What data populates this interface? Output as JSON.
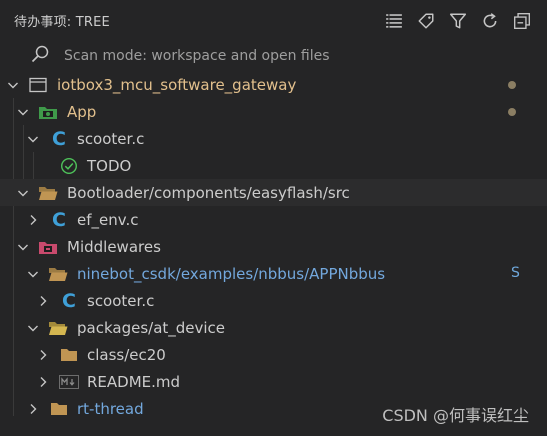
{
  "header": {
    "title": "待办事项: TREE"
  },
  "scan": {
    "text": "Scan mode: workspace and open files"
  },
  "tree": {
    "root": "iotbox3_mcu_software_gateway",
    "app": "App",
    "scooter_c_1": "scooter.c",
    "todo": "TODO",
    "bootloader": "Bootloader/components/easyflash/src",
    "ef_env": "ef_env.c",
    "middlewares": "Middlewares",
    "ninebot": "ninebot_csdk/examples/nbbus/APPNbbus",
    "ninebot_badge": "S",
    "scooter_c_2": "scooter.c",
    "packages": "packages/at_device",
    "class_ec20": "class/ec20",
    "readme": "README.md",
    "rtthread": "rt-thread"
  },
  "watermark": "CSDN @何事误红尘",
  "colors": {
    "background": "#252526",
    "modified_text": "#e2c08d",
    "untracked_text": "#73a8dd",
    "c_icon": "#3fa0d8",
    "folder": "#c09553"
  }
}
